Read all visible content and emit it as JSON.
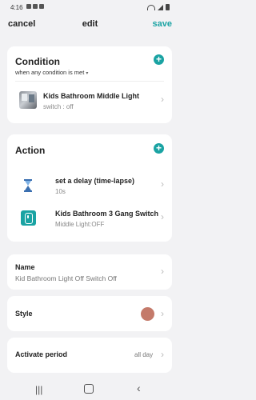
{
  "status": {
    "time": "4:16"
  },
  "header": {
    "cancel_label": "cancel",
    "title": "edit",
    "save_label": "save"
  },
  "condition": {
    "title": "Condition",
    "mode": "when any condition is met",
    "item": {
      "name": "Kids Bathroom Middle Light",
      "detail": "switch : off"
    }
  },
  "action": {
    "title": "Action",
    "items": [
      {
        "name": "set a delay (time-lapse)",
        "detail": "10s",
        "icon": "hourglass-icon"
      },
      {
        "name": "Kids Bathroom 3 Gang Switch",
        "detail": "Middle Light:OFF",
        "icon": "switch-icon"
      }
    ]
  },
  "name_field": {
    "label": "Name",
    "value": "Kid Bathroom Light Off Switch Off"
  },
  "style_field": {
    "label": "Style",
    "color": "#c47a6a"
  },
  "activate_field": {
    "label": "Activate period",
    "value": "all day"
  },
  "colors": {
    "accent": "#1aa3a3"
  }
}
